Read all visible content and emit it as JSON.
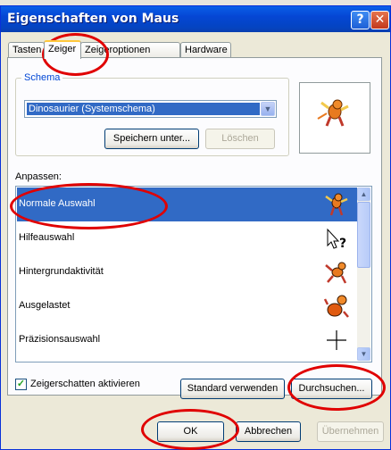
{
  "window": {
    "title": "Eigenschaften von Maus",
    "help_icon": "?",
    "close_icon": "✕"
  },
  "tabs": [
    {
      "label": "Tasten"
    },
    {
      "label": "Zeiger",
      "active": true
    },
    {
      "label": "Zeigeroptionen"
    },
    {
      "label": "Hardware"
    }
  ],
  "scheme": {
    "group_label": "Schema",
    "selected": "Dinosaurier (Systemschema)",
    "save_label": "Speichern unter...",
    "delete_label": "Löschen"
  },
  "customize": {
    "label": "Anpassen:",
    "items": [
      {
        "label": "Normale Auswahl",
        "selected": true,
        "icon": "dino-normal-icon"
      },
      {
        "label": "Hilfeauswahl",
        "icon": "help-select-icon"
      },
      {
        "label": "Hintergrundaktivität",
        "icon": "dino-background-icon"
      },
      {
        "label": "Ausgelastet",
        "icon": "dino-busy-icon"
      },
      {
        "label": "Präzisionsauswahl",
        "icon": "crosshair-icon"
      }
    ]
  },
  "shadow": {
    "label": "Zeigerschatten aktivieren",
    "checked": true,
    "check_glyph": "✓"
  },
  "buttons": {
    "default_label": "Standard verwenden",
    "browse_label": "Durchsuchen...",
    "ok_label": "OK",
    "cancel_label": "Abbrechen",
    "apply_label": "Übernehmen"
  },
  "colors": {
    "selection": "#316ac5",
    "annotation": "#e00000",
    "title_bar": "#0546d4"
  }
}
